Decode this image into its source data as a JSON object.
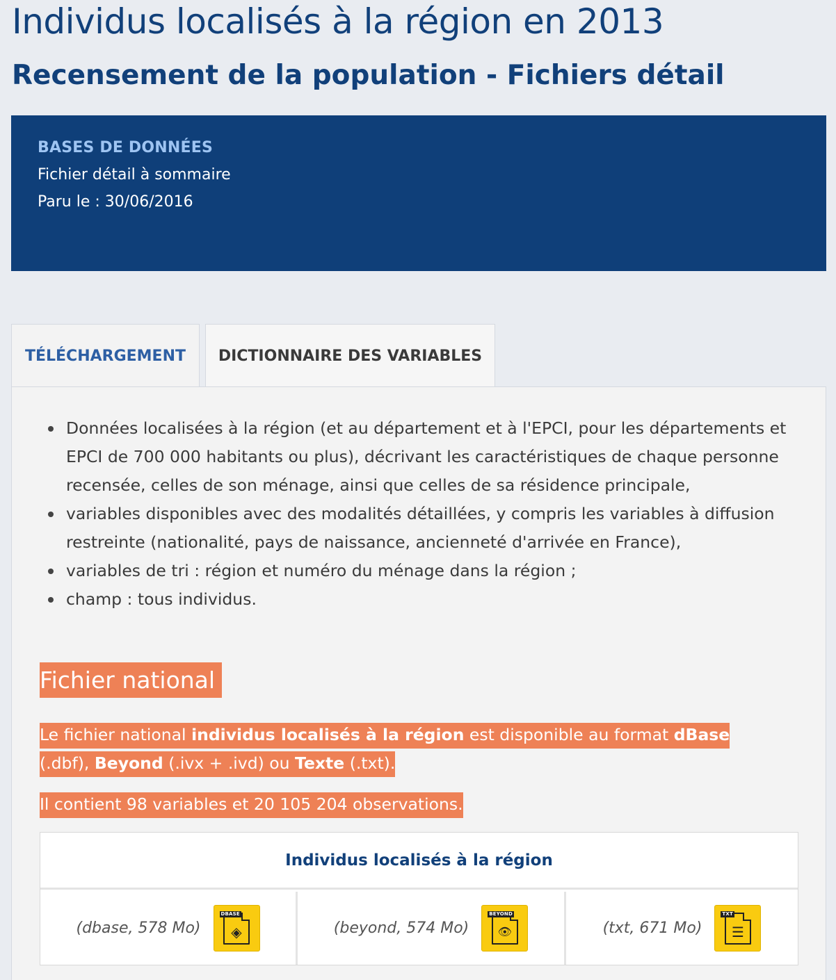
{
  "header": {
    "title": "Individus localisés à la région en 2013",
    "subtitle": "Recensement de la population - Fichiers détail"
  },
  "infobox": {
    "kind": "BASES DE DONNÉES",
    "type_line": "Fichier détail à sommaire",
    "date_line": "Paru le : 30/06/2016"
  },
  "tabs": [
    {
      "label": "TÉLÉCHARGEMENT",
      "active": true
    },
    {
      "label": "DICTIONNAIRE DES VARIABLES",
      "active": false
    }
  ],
  "bullets": [
    "Données localisées à la région (et au département et à l'EPCI, pour les départements et EPCI de 700 000 habitants ou plus), décrivant les caractéristiques de chaque personne recensée, celles de son ménage, ainsi que celles de sa résidence principale,",
    "variables disponibles avec des modalités détaillées, y compris les variables à diffusion restreinte (nationalité, pays de naissance, ancienneté d'arrivée en France),",
    "variables de tri : région et numéro du ménage dans la région ;",
    "champ : tous individus."
  ],
  "section": {
    "title": "Fichier national",
    "para1": {
      "t1": "Le fichier national ",
      "b1": "individus localisés à la région",
      "t2": " est disponible au format ",
      "b2": "dBase",
      "t3": " (.dbf), ",
      "b3": "Beyond",
      "t4": " (.ivx + .ivd) ou ",
      "b4": "Texte",
      "t5": " (.txt)."
    },
    "para2": "Il contient 98 variables et 20 105 204 observations."
  },
  "downloads": {
    "heading": "Individus localisés à la région",
    "files": [
      {
        "label": "(dbase, 578 Mo)",
        "tag": "DBASE",
        "icon": "dbase-file-icon",
        "glyph": "◈"
      },
      {
        "label": "(beyond, 574 Mo)",
        "tag": "BEYOND",
        "icon": "beyond-file-icon",
        "glyph": "👁"
      },
      {
        "label": "(txt, 671 Mo)",
        "tag": "TXT",
        "icon": "txt-file-icon",
        "glyph": "☰"
      }
    ]
  },
  "colors": {
    "title": "#11407a",
    "infobox_bg": "#0f3f79",
    "highlight": "#ee8156",
    "icon_yellow": "#f9cb10"
  }
}
